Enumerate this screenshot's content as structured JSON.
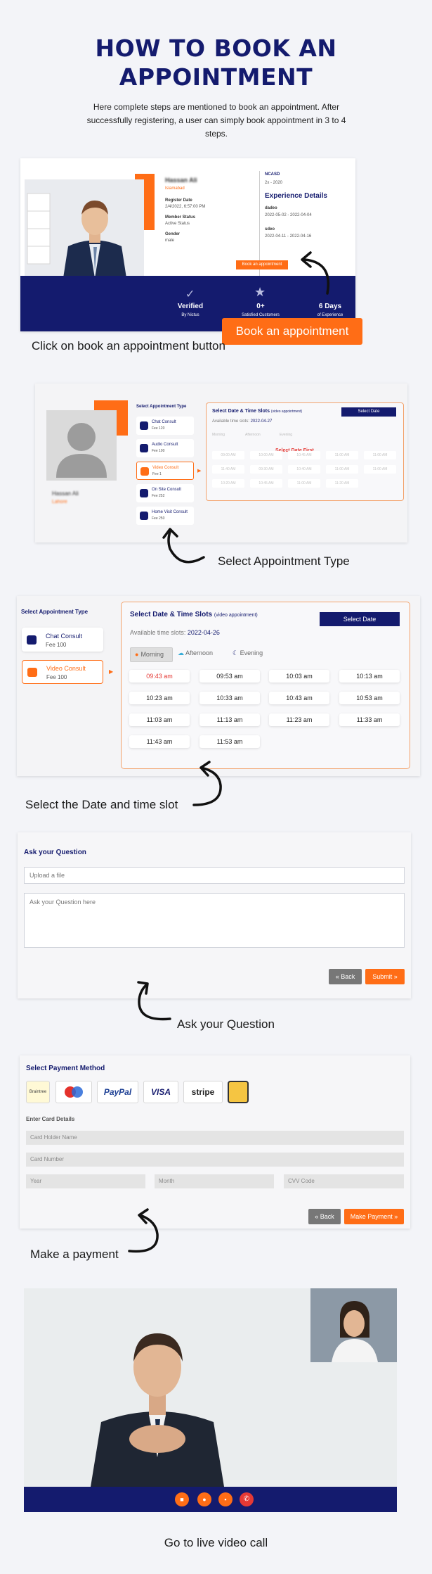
{
  "heading": {
    "line1": "HOW TO BOOK AN",
    "line2": "APPOINTMENT"
  },
  "intro": "Here complete steps are mentioned to book an appointment. After successfully registering, a user can simply book appointment in 3 to 4 steps.",
  "step1": {
    "caption": "Click on book an appointment button",
    "cta": "Book an appointment",
    "profile": {
      "name": "Hassan Ali",
      "location": "Islamabad",
      "register_date_label": "Register Date",
      "register_date": "2/4/2022, 6:57:00 PM",
      "member_status_label": "Member Status",
      "member_status": "Active Status",
      "gender_label": "Gender",
      "gender": "male"
    },
    "experience": {
      "org": "NCASD",
      "years": "2x - 2020",
      "title": "Experience Details",
      "item1_label": "dadeo",
      "item1_dates": "2022-05-02 - 2022-04-04",
      "item2_label": "sdeo",
      "item2_dates": "2022-04-11 - 2022-04-16"
    },
    "small_button": "Book an appointment",
    "stats": [
      {
        "label": "Verified",
        "sub": "By Nictus"
      },
      {
        "label": "0+",
        "sub": "Satisfied Customers"
      },
      {
        "label": "6 Days",
        "sub": "of Experience"
      }
    ]
  },
  "step2": {
    "caption": "Select Appointment Type",
    "name": "Hassan Ali",
    "location": "Lahore",
    "types_title": "Select Appointment Type",
    "types": [
      {
        "name": "Chat Consult",
        "fee": "Fee 120"
      },
      {
        "name": "Audio Consult",
        "fee": "Fee 100"
      },
      {
        "name": "Video Consult",
        "fee": "Fee 1"
      },
      {
        "name": "On Site Consult",
        "fee": "Fee 252"
      },
      {
        "name": "Home Visit Consult",
        "fee": "Fee 250"
      }
    ],
    "slots_title": "Select Date & Time Slots",
    "slots_sub": "(video appointment)",
    "available": "Available time slots:",
    "date": "2022-04-27",
    "select_date": "Select Date",
    "periods": [
      "Morning",
      "Afternoon",
      "Evening"
    ],
    "first_notice": "Select Date First",
    "times": [
      "09:00 AM",
      "10:00 AM",
      "10:45 AM",
      "11:00 AM",
      "11:00 AM",
      "11:40 AM",
      "09:30 AM",
      "10:40 AM",
      "11:00 AM",
      "11:00 AM",
      "10:20 AM",
      "10:45 AM",
      "11:00 AM",
      "11:20 AM"
    ]
  },
  "step3": {
    "caption": "Select the Date and time slot",
    "types_title": "Select Appointment Type",
    "types": [
      {
        "name": "Chat Consult",
        "fee": "Fee 100"
      },
      {
        "name": "Video Consult",
        "fee": "Fee 100"
      }
    ],
    "slots_title": "Select Date & Time Slots",
    "slots_sub": "(video appointment)",
    "available": "Available time slots:",
    "date": "2022-04-26",
    "select_date": "Select Date",
    "periods": [
      "Morning",
      "Afternoon",
      "Evening"
    ],
    "times": [
      "09:43 am",
      "09:53 am",
      "10:03 am",
      "10:13 am",
      "10:23 am",
      "10:33 am",
      "10:43 am",
      "10:53 am",
      "11:03 am",
      "11:13 am",
      "11:23 am",
      "11:33 am",
      "11:43 am",
      "11:53 am"
    ]
  },
  "step4": {
    "caption": "Ask your Question",
    "title": "Ask your Question",
    "upload_placeholder": "Upload a file",
    "question_placeholder": "Ask your Question here",
    "back": "Back",
    "submit": "Submit"
  },
  "step5": {
    "caption": "Make a payment",
    "title": "Select Payment Method",
    "methods": [
      "Braintree",
      "Maestro",
      "PayPal",
      "VISA",
      "stripe"
    ],
    "card_title": "Enter Card Details",
    "holder": "Card Holder Name",
    "number": "Card Number",
    "year": "Year",
    "month": "Month",
    "cvv": "CVV Code",
    "back": "Back",
    "pay": "Make Payment"
  },
  "step6": {
    "caption": "Go to live video call"
  },
  "colors": {
    "navy": "#141b6e",
    "orange": "#ff6d16",
    "slot_red": "#e53935"
  }
}
